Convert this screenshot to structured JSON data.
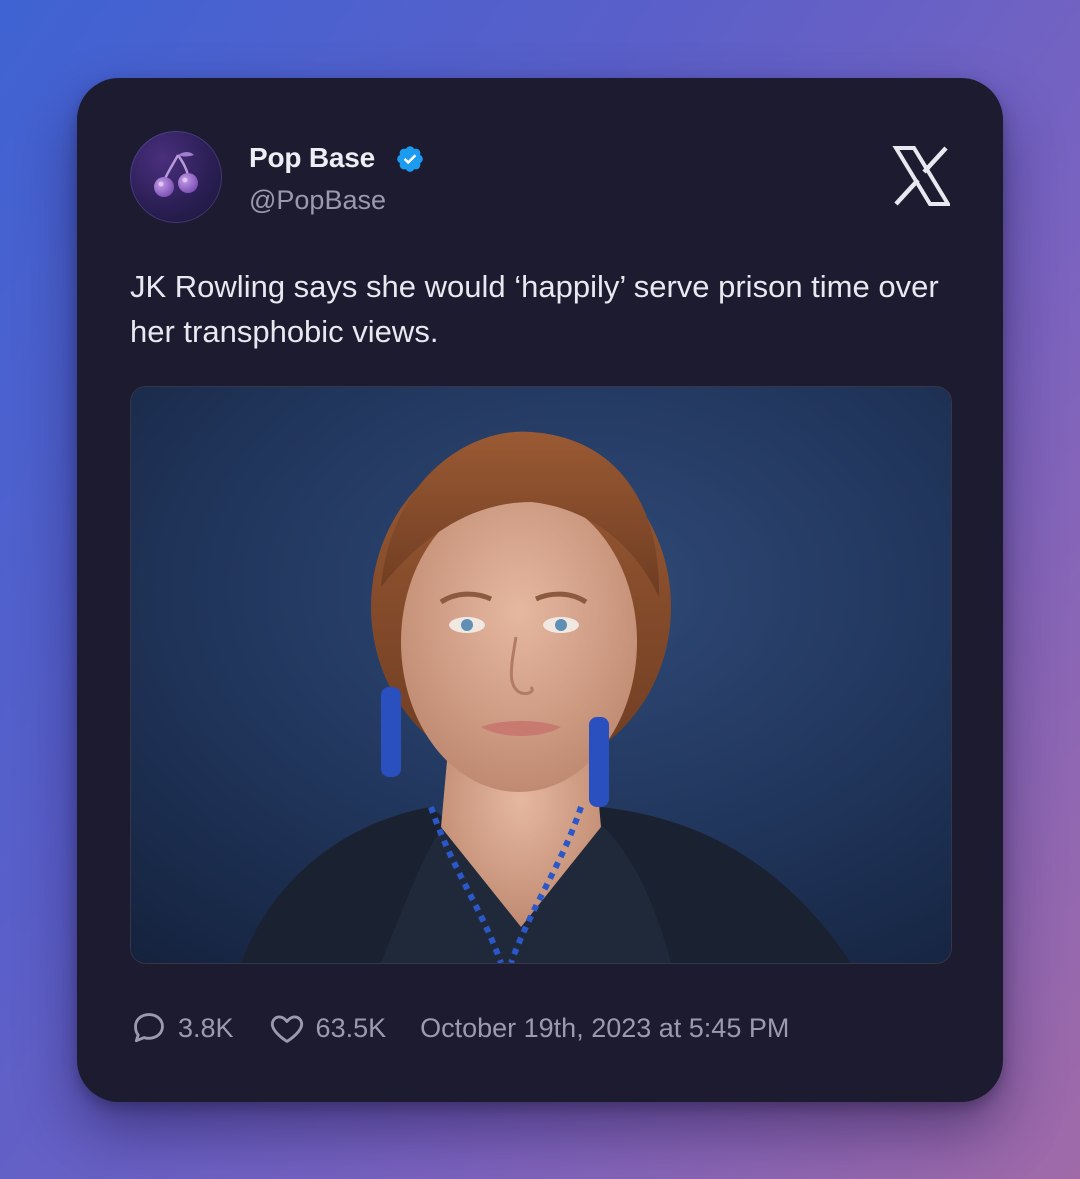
{
  "author": {
    "name": "Pop Base",
    "handle": "@PopBase",
    "verified": true,
    "avatar_icon": "cherries-icon"
  },
  "platform_icon": "x-logo-icon",
  "tweet": {
    "text": "JK Rowling says she would ‘happily’ serve prison time over her transphobic views."
  },
  "media": {
    "type": "photo"
  },
  "stats": {
    "replies": "3.8K",
    "likes": "63.5K",
    "timestamp": "October 19th, 2023 at 5:45 PM"
  },
  "colors": {
    "card_bg": "#1c1b2f",
    "verified_blue": "#1d9bf0",
    "muted_text": "#9b9bb0"
  }
}
